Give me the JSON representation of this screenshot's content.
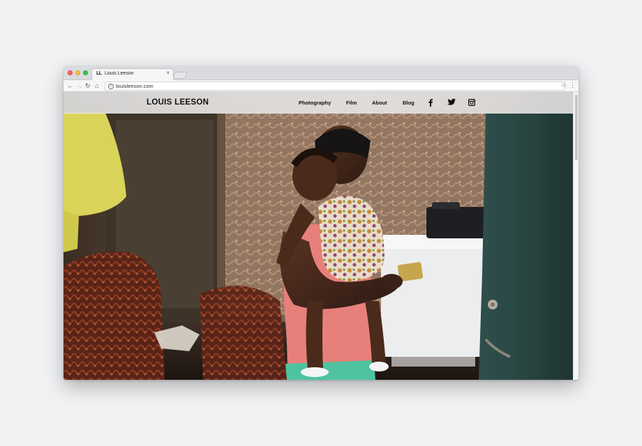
{
  "browser": {
    "tab_favicon_text": "LL",
    "tab_title": "Louis Leeson",
    "tab_close": "×",
    "url": "louisleeson.com",
    "info_glyph": "i",
    "back_glyph": "←",
    "forward_glyph": "→",
    "reload_glyph": "↻",
    "home_glyph": "⌂",
    "star_glyph": "☆",
    "menu_glyph": "⋮"
  },
  "site": {
    "logo": "LOUIS LEESON",
    "nav": [
      {
        "label": "Photography"
      },
      {
        "label": "Film"
      },
      {
        "label": "About"
      },
      {
        "label": "Blog"
      }
    ],
    "social": [
      "facebook-icon",
      "twitter-icon",
      "instagram-icon"
    ]
  },
  "colors": {
    "page_background": "#f1f2f4",
    "header_overlay": "#eeeeee",
    "text": "#111111"
  }
}
